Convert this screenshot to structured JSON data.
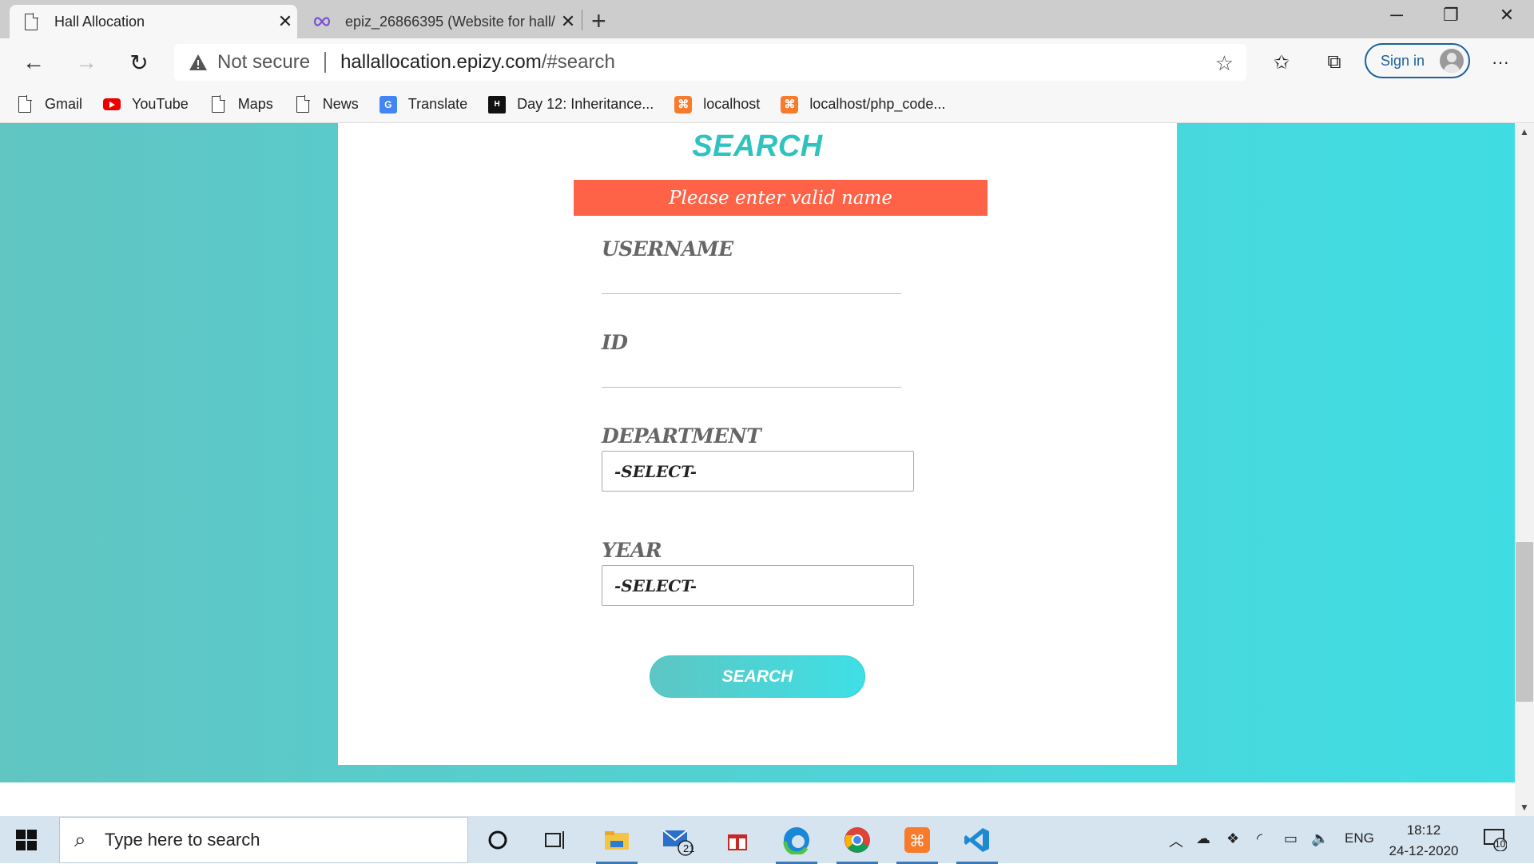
{
  "browser": {
    "tabs": [
      {
        "title": "Hall Allocation",
        "active": true
      },
      {
        "title": "epiz_26866395 (Website for hall/",
        "active": false
      }
    ],
    "address": {
      "security_label": "Not secure",
      "host": "hallallocation.epizy.com",
      "path": "/#search"
    },
    "sign_in_label": "Sign in",
    "bookmarks": [
      {
        "label": "Gmail",
        "icon": "document-icon"
      },
      {
        "label": "YouTube",
        "icon": "youtube-icon"
      },
      {
        "label": "Maps",
        "icon": "document-icon"
      },
      {
        "label": "News",
        "icon": "document-icon"
      },
      {
        "label": "Translate",
        "icon": "google-translate-icon"
      },
      {
        "label": "Day 12: Inheritance...",
        "icon": "hackerrank-icon"
      },
      {
        "label": "localhost",
        "icon": "xampp-icon"
      },
      {
        "label": "localhost/php_code...",
        "icon": "xampp-icon"
      }
    ]
  },
  "page": {
    "title": "SEARCH",
    "error_message": "Please enter valid name",
    "fields": {
      "username_label": "USERNAME",
      "username_value": "",
      "id_label": "ID",
      "id_value": "",
      "department_label": "DEPARTMENT",
      "department_selected": "-SELECT-",
      "year_label": "YEAR",
      "year_selected": "-SELECT-"
    },
    "search_button": "SEARCH",
    "colors": {
      "accent": "#2ec3bf",
      "error": "#ff6347",
      "background_from": "#61c5c2",
      "background_to": "#3fdde3"
    }
  },
  "taskbar": {
    "search_placeholder": "Type here to search",
    "mail_badge": "21",
    "language": "ENG",
    "time": "18:12",
    "date": "24-12-2020",
    "notification_count": "10"
  }
}
